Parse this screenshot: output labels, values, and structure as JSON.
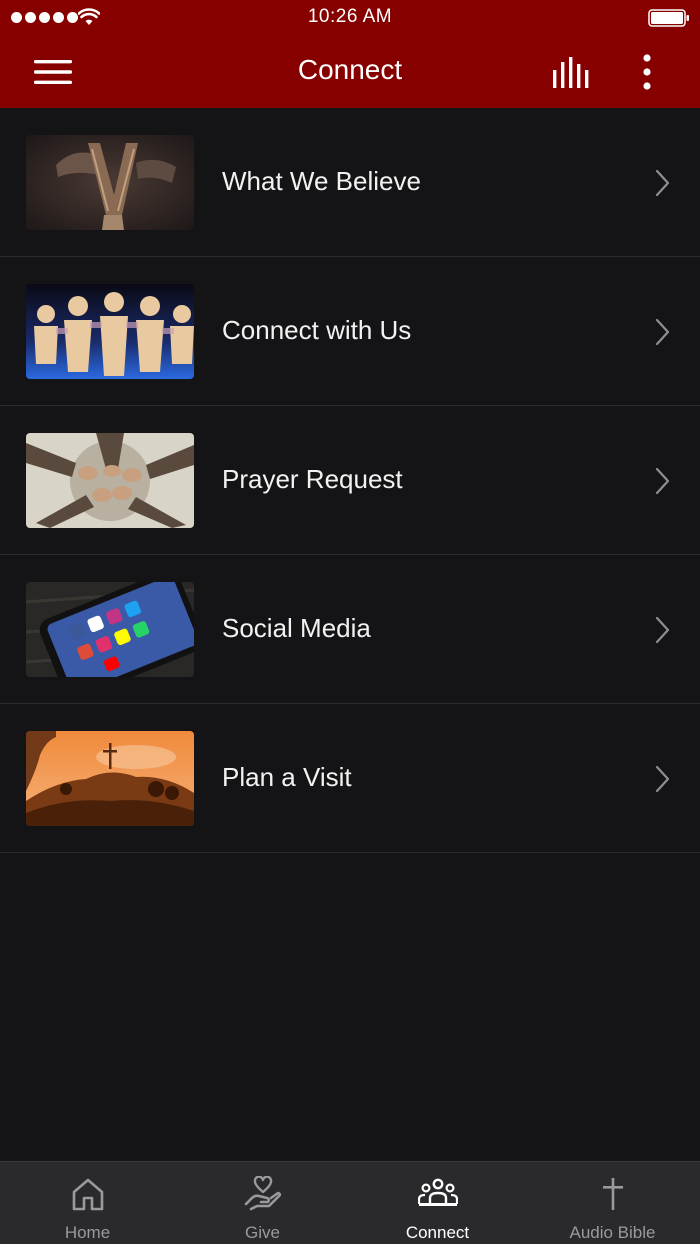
{
  "status_bar": {
    "time": "10:26 AM"
  },
  "nav": {
    "title": "Connect",
    "menu_icon": "hamburger-menu-icon",
    "bars_icon": "audio-bars-icon",
    "more_icon": "vertical-ellipsis-icon"
  },
  "colors": {
    "header": "#870000",
    "background": "#141416",
    "tab_bar": "#2a2a2d",
    "tab_inactive": "#9a9a9e",
    "tab_active": "#ffffff"
  },
  "list": {
    "items": [
      {
        "label": "What We Believe",
        "thumbnail": "hands-holding-bible"
      },
      {
        "label": "Connect with Us",
        "thumbnail": "paper-people-chain"
      },
      {
        "label": "Prayer Request",
        "thumbnail": "people-praying-circle"
      },
      {
        "label": "Social Media",
        "thumbnail": "phone-social-apps"
      },
      {
        "label": "Plan a Visit",
        "thumbnail": "cross-on-hill-sunset"
      }
    ]
  },
  "tab_bar": {
    "active": "Connect",
    "tabs": [
      {
        "label": "Home",
        "icon": "home-icon"
      },
      {
        "label": "Give",
        "icon": "give-heart-hand-icon"
      },
      {
        "label": "Connect",
        "icon": "group-people-icon"
      },
      {
        "label": "Audio Bible",
        "icon": "cross-icon"
      }
    ]
  }
}
